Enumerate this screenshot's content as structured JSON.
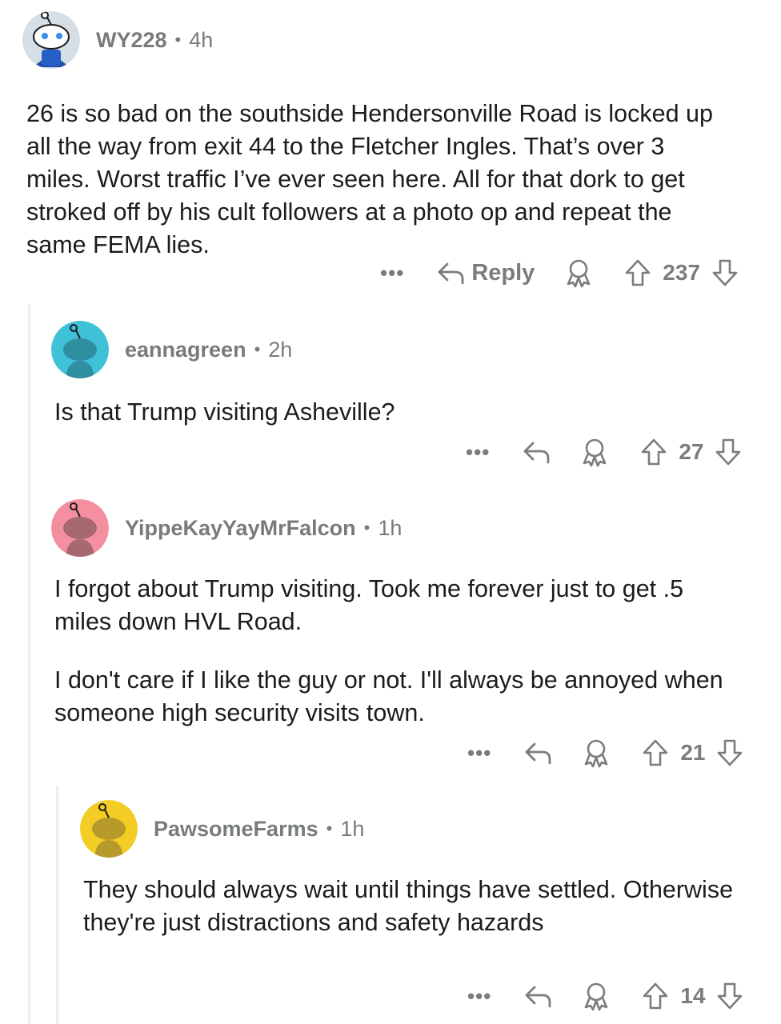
{
  "comments": [
    {
      "username": "WY228",
      "age": "4h",
      "avatar_color": "#d6dfe6",
      "paragraphs": [
        "26 is so bad on the southside Hendersonville Road is locked up all the way from exit 44 to the Fletcher Ingles. That’s over 3 miles. Worst traffic I’ve ever seen here. All for that dork to get stroked off by his cult followers at a photo op and repeat the same FEMA lies."
      ],
      "more_label": "•••",
      "reply_label": "Reply",
      "votes": "237"
    },
    {
      "username": "eannagreen",
      "age": "2h",
      "avatar_color": "#3fc1d8",
      "paragraphs": [
        "Is that Trump visiting Asheville?"
      ],
      "more_label": "•••",
      "votes": "27"
    },
    {
      "username": "YippeKayYayMrFalcon",
      "age": "1h",
      "avatar_color": "#f58fa0",
      "paragraphs": [
        "I forgot about Trump visiting.  Took me forever just to get .5 miles down HVL Road.",
        "I don't care if I like the guy or not.  I'll always be annoyed when someone high security visits town."
      ],
      "more_label": "•••",
      "votes": "21"
    },
    {
      "username": "PawsomeFarms",
      "age": "1h",
      "avatar_color": "#f3cd24",
      "paragraphs": [
        "They should always wait until things have settled. Otherwise they're just distractions and safety hazards"
      ],
      "more_label": "•••",
      "votes": "14"
    }
  ],
  "separator": "•",
  "colors": {
    "meta": "#777b7e",
    "text": "#1c1c1c",
    "icon": "#7c7c7c",
    "thread_line": "#eceff1"
  },
  "icons": [
    "more-icon",
    "reply-icon",
    "award-icon",
    "upvote-icon",
    "downvote-icon"
  ]
}
